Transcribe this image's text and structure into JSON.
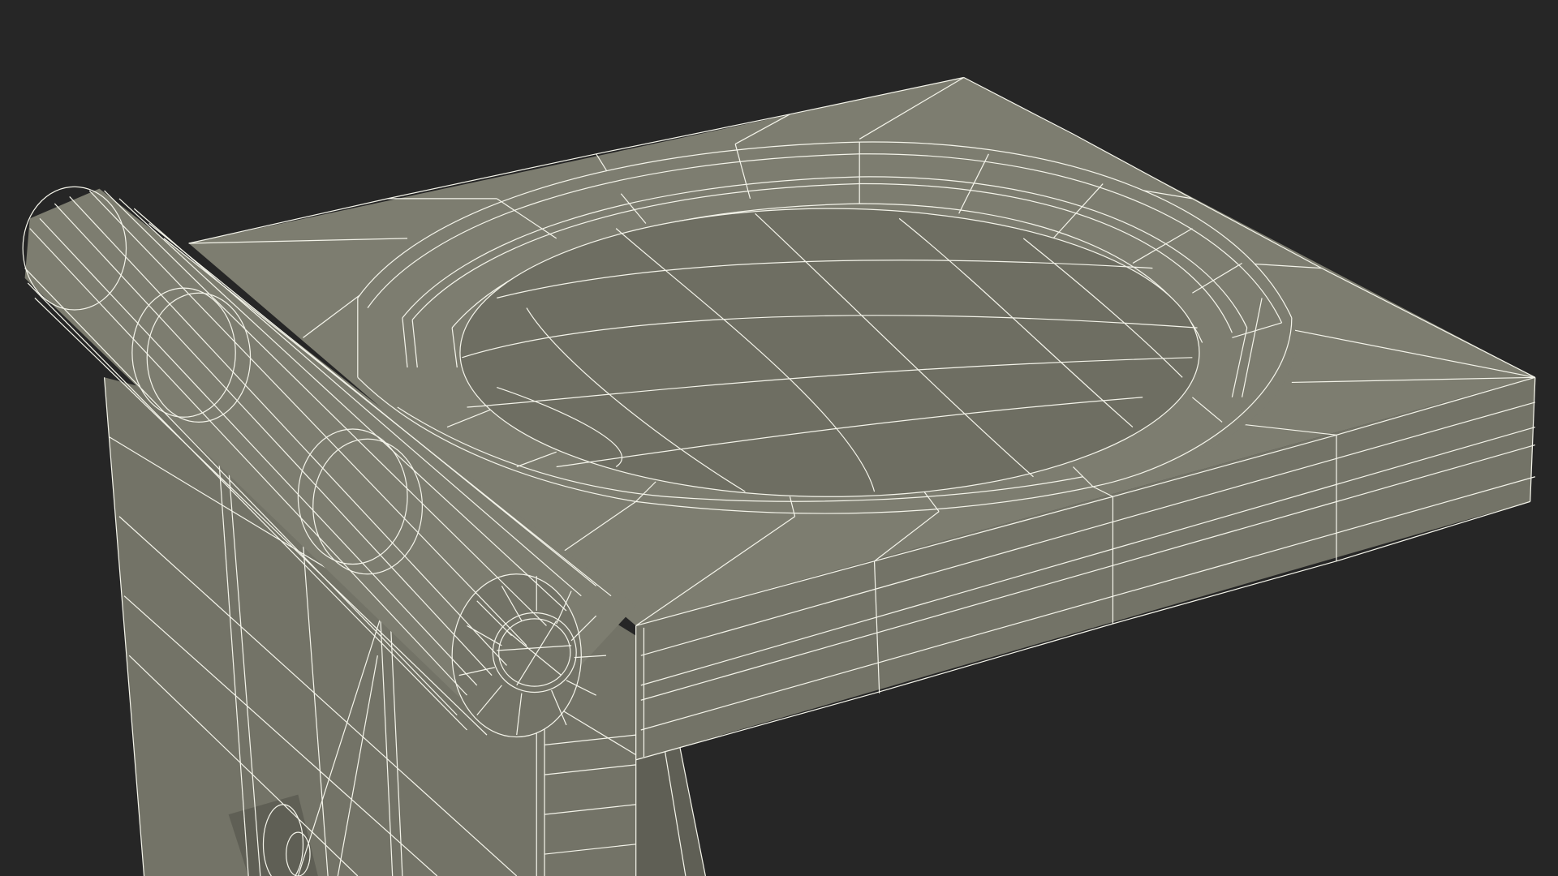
{
  "scene": {
    "subject": "wireframe-3d-model-render",
    "colors": {
      "background": "#262626",
      "surface_light": "#7d7d70",
      "surface_mid": "#737367",
      "surface_dark": "#5f5f55",
      "recess": "#6e6e62",
      "wire": "#f4f4ea"
    }
  }
}
